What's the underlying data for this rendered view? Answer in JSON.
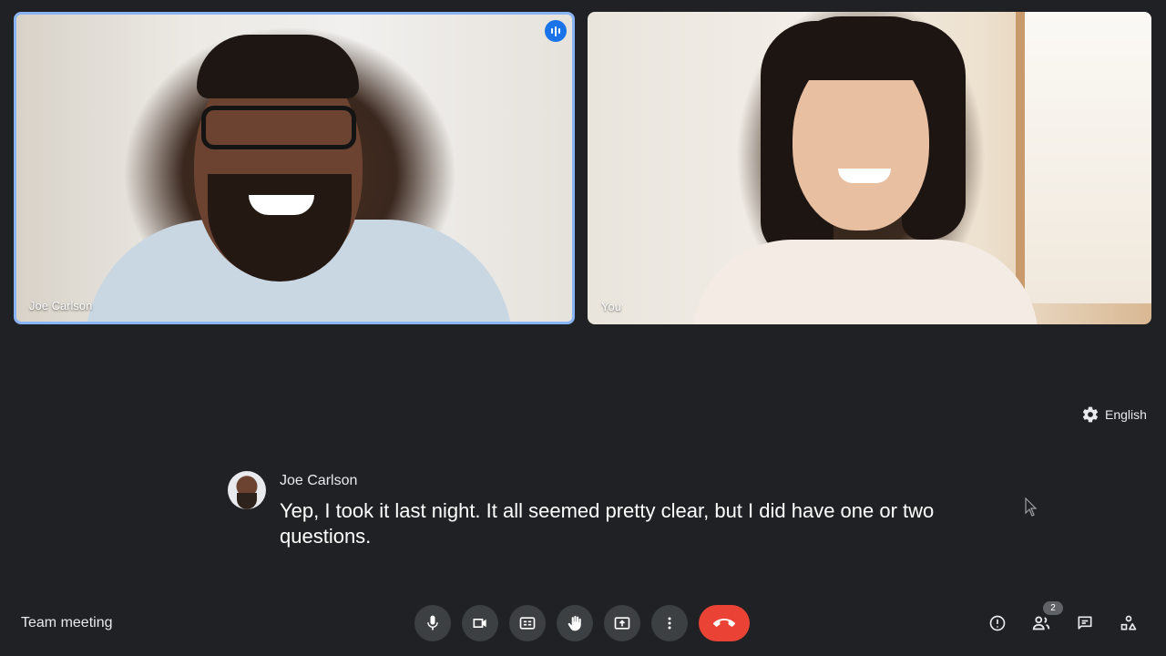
{
  "participants": [
    {
      "name": "Joe Carlson",
      "speaking": true
    },
    {
      "name": "You",
      "speaking": false
    }
  ],
  "captions": {
    "language": "English",
    "speaker": "Joe Carlson",
    "text": "Yep, I took it last night. It all seemed pretty clear, but I did have one or two questions."
  },
  "meeting": {
    "name": "Team meeting"
  },
  "controls": [
    {
      "name": "microphone",
      "icon": "mic-icon"
    },
    {
      "name": "camera",
      "icon": "camera-icon"
    },
    {
      "name": "captions",
      "icon": "closed-captions-icon"
    },
    {
      "name": "raise-hand",
      "icon": "hand-icon"
    },
    {
      "name": "present",
      "icon": "present-screen-icon"
    },
    {
      "name": "more-options",
      "icon": "more-vert-icon"
    },
    {
      "name": "leave-call",
      "icon": "hang-up-icon"
    }
  ],
  "side_controls": {
    "people_count": "2",
    "icons": [
      "info-icon",
      "people-icon",
      "chat-icon",
      "activities-icon"
    ]
  },
  "colors": {
    "background": "#202124",
    "active_border": "#8ab4f8",
    "hangup": "#ea4335",
    "speaking_indicator": "#1a73e8"
  }
}
